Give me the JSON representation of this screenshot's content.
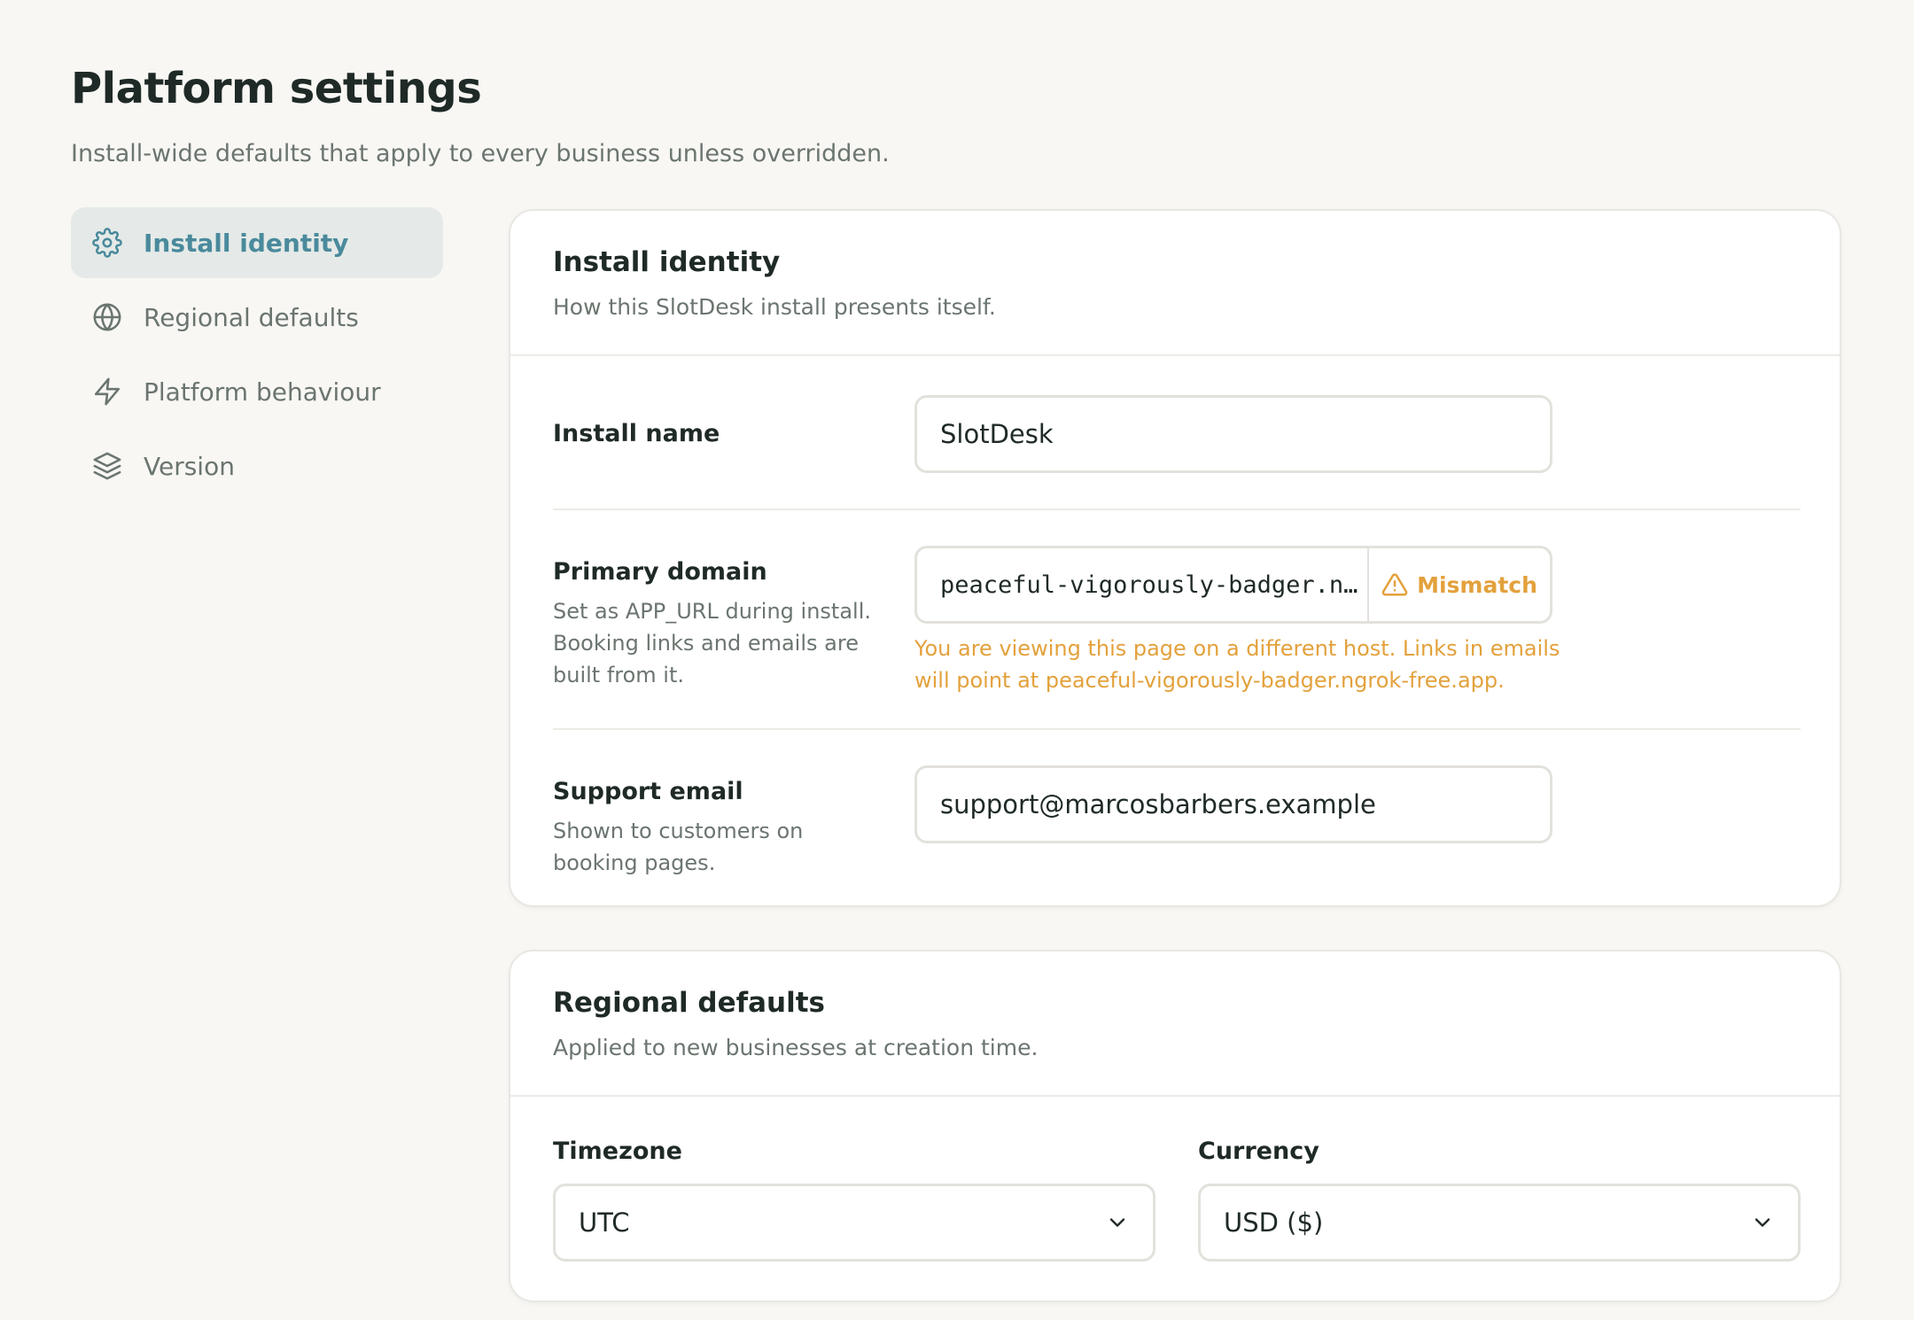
{
  "header": {
    "title": "Platform settings",
    "subtitle": "Install-wide defaults that apply to every business unless overridden."
  },
  "sidebar": {
    "items": [
      {
        "label": "Install identity",
        "icon": "gear-icon",
        "active": true
      },
      {
        "label": "Regional defaults",
        "icon": "globe-icon",
        "active": false
      },
      {
        "label": "Platform behaviour",
        "icon": "lightning-icon",
        "active": false
      },
      {
        "label": "Version",
        "icon": "layers-icon",
        "active": false
      }
    ]
  },
  "identity": {
    "title": "Install identity",
    "description": "How this SlotDesk install presents itself.",
    "install_name": {
      "label": "Install name",
      "value": "SlotDesk"
    },
    "primary_domain": {
      "label": "Primary domain",
      "help": "Set as APP_URL during install. Booking links and emails are built from it.",
      "value": "peaceful-vigorously-badger.n…",
      "badge": "Mismatch",
      "warning": "You are viewing this page on a different host. Links in emails will point at peaceful-vigorously-badger.ngrok-free.app."
    },
    "support_email": {
      "label": "Support email",
      "help": "Shown to customers on booking pages.",
      "value": "support@marcosbarbers.example"
    }
  },
  "regional": {
    "title": "Regional defaults",
    "description": "Applied to new businesses at creation time.",
    "timezone": {
      "label": "Timezone",
      "value": "UTC"
    },
    "currency": {
      "label": "Currency",
      "value": "USD ($)"
    }
  },
  "colors": {
    "accent": "#4a8a9c",
    "warning": "#e3a13c",
    "background": "#f8f7f4"
  }
}
